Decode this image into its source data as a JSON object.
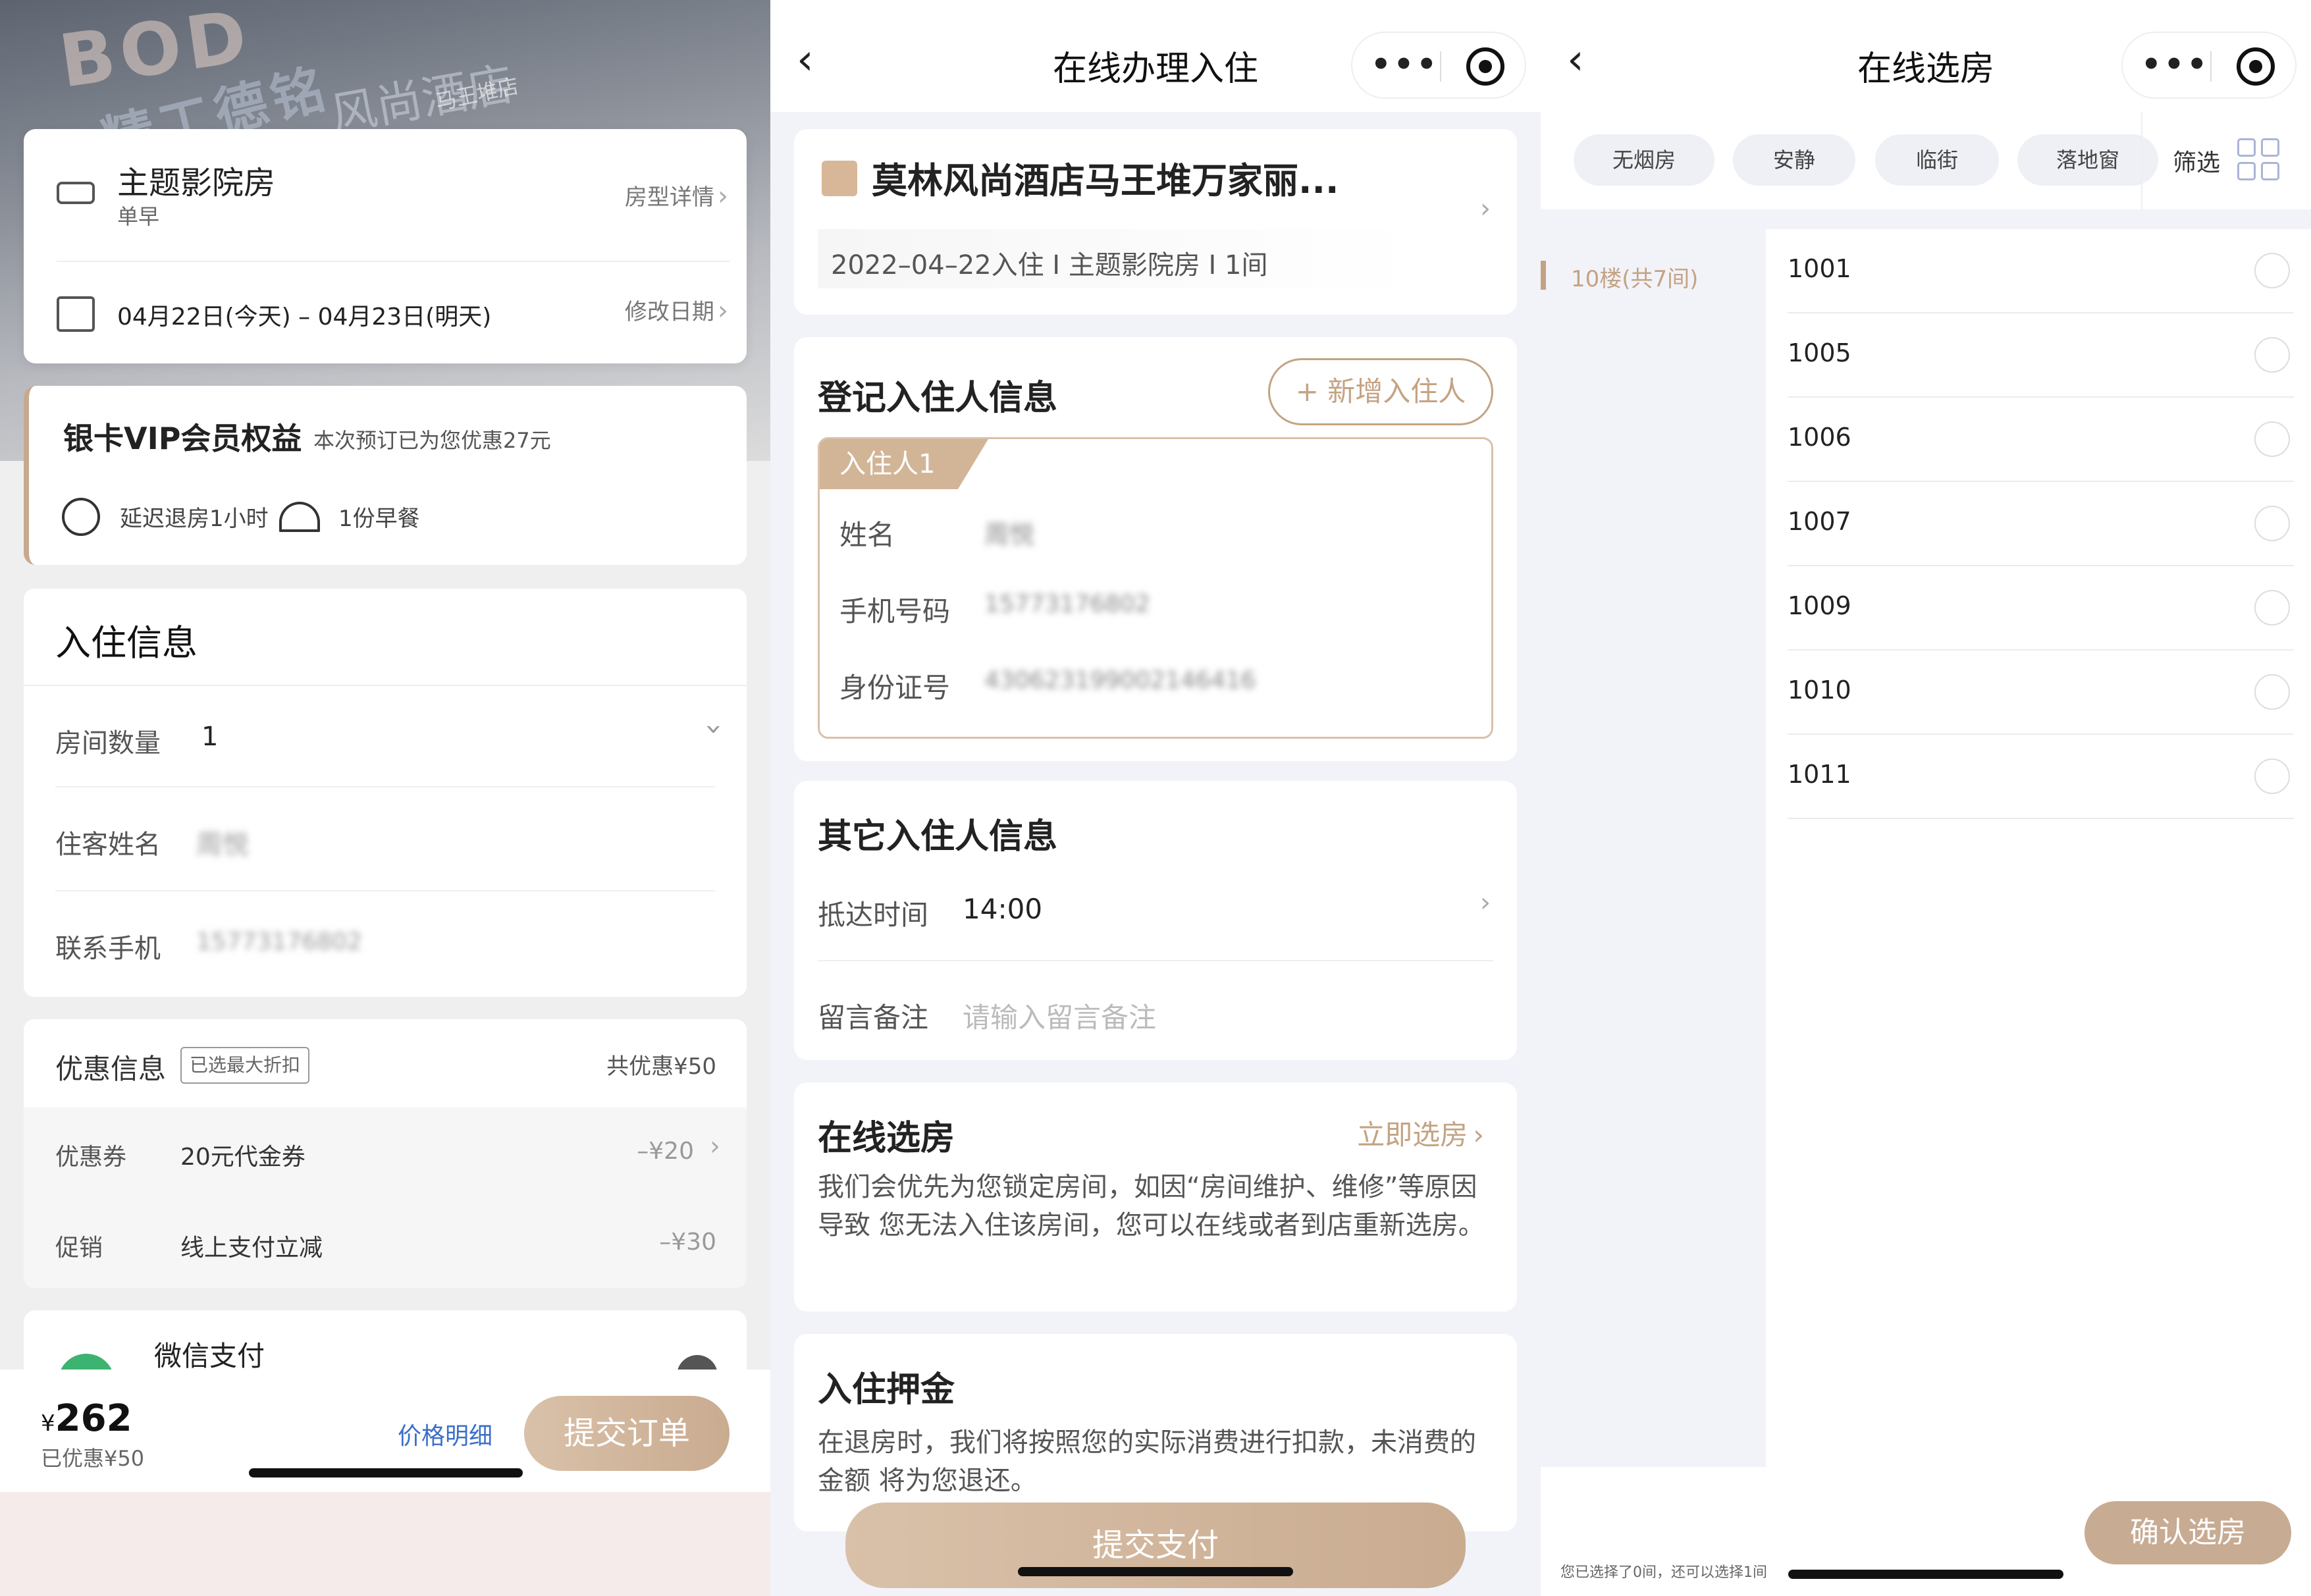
{
  "p1": {
    "hero_sign": "BOD",
    "hero_sign2": "精工德铭",
    "hero_sign3": "风尚酒店",
    "hero_sign4": "马王堆店",
    "room": {
      "name": "主题影院房",
      "meal": "单早",
      "detail_link": "房型详情"
    },
    "dates": {
      "text": "04月22日(今天) – 04月23日(明天)",
      "modify_link": "修改日期"
    },
    "vip": {
      "title": "银卡VIP会员权益",
      "note": "本次预订已为您优惠27元",
      "perk1": "延迟退房1小时",
      "perk2": "1份早餐"
    },
    "checkin": {
      "title": "入住信息",
      "room_count_label": "房间数量",
      "room_count_value": "1",
      "guest_label": "住客姓名",
      "guest_value": "周悦",
      "phone_label": "联系手机",
      "phone_value": "15773176802"
    },
    "discount": {
      "title": "优惠信息",
      "badge": "已选最大折扣",
      "total": "共优惠¥50",
      "coupon_label": "优惠券",
      "coupon_name": "20元代金券",
      "coupon_value": "–¥20",
      "promo_label": "促销",
      "promo_name": "线上支付立减",
      "promo_value": "–¥30"
    },
    "payment": {
      "method": "微信支付"
    },
    "bottom": {
      "currency": "¥",
      "price": "262",
      "saved": "已优惠¥50",
      "price_detail": "价格明细",
      "submit": "提交订单"
    }
  },
  "p2": {
    "nav_title": "在线办理入住",
    "hotel": {
      "name": "莫林风尚酒店马王堆万家丽...",
      "summary": "2022–04–22入住 I 主题影院房 I 1间"
    },
    "register": {
      "title": "登记入住人信息",
      "add_btn": "+ 新增入住人",
      "tab": "入住人1",
      "name_label": "姓名",
      "name_value": "周悦",
      "phone_label": "手机号码",
      "phone_value": "15773176802",
      "id_label": "身份证号",
      "id_value": "430623199002146416"
    },
    "other": {
      "title": "其它入住人信息",
      "arrival_label": "抵达时间",
      "arrival_value": "14:00",
      "note_label": "留言备注",
      "note_placeholder": "请输入留言备注"
    },
    "select_room": {
      "title": "在线选房",
      "link": "立即选房",
      "desc": "我们会优先为您锁定房间，如因“房间维护、维修”等原因导致 您无法入住该房间，您可以在线或者到店重新选房。"
    },
    "deposit": {
      "title": "入住押金",
      "desc": "在退房时，我们将按照您的实际消费进行扣款，未消费的金额 将为您退还。"
    },
    "submit": "提交支付"
  },
  "p3": {
    "nav_title": "在线选房",
    "tags": [
      "无烟房",
      "安静",
      "临街",
      "落地窗"
    ],
    "filter": "筛选",
    "floor": "10楼(共7间)",
    "rooms": [
      "1001",
      "1005",
      "1006",
      "1007",
      "1009",
      "1010",
      "1011"
    ],
    "footer_note": "您已选择了0间，还可以选择1间",
    "confirm": "确认选房"
  },
  "colors": {
    "gold": "#c4a383",
    "button_gradient_start": "#d9c1a9",
    "button_gradient_end": "#c9ab90",
    "blue_link": "#3b6fc9"
  }
}
